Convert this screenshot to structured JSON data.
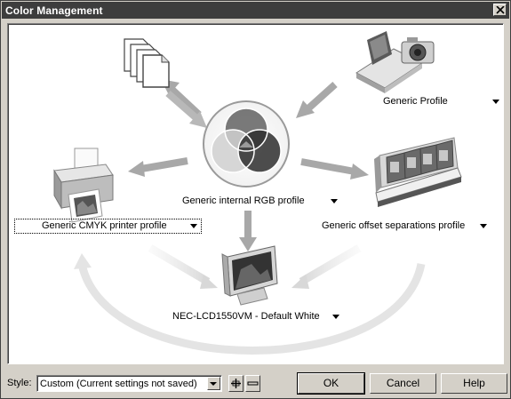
{
  "window": {
    "title": "Color Management",
    "close_glyph": "×"
  },
  "diagram": {
    "center_label": "Generic internal RGB profile",
    "scanner_label": "Generic Profile",
    "cmyk_printer_label": "Generic CMYK printer profile",
    "separations_label": "Generic offset separations profile",
    "monitor_label": "NEC-LCD1550VM - Default White",
    "icons": [
      "documents-icon",
      "scanner-camera-icon",
      "desktop-printer-icon",
      "offset-press-icon",
      "monitor-icon",
      "rgb-color-wheel-icon"
    ]
  },
  "footer": {
    "style_label": "Style:",
    "style_value": "Custom (Current settings not saved)",
    "ok_label": "OK",
    "cancel_label": "Cancel",
    "help_label": "Help"
  },
  "colors": {
    "titlebar": "#3d3d3d",
    "arrow": "#a8a8a8",
    "gamut_arc": "#e2e2e2",
    "dialog_face": "#d4d0c8"
  }
}
